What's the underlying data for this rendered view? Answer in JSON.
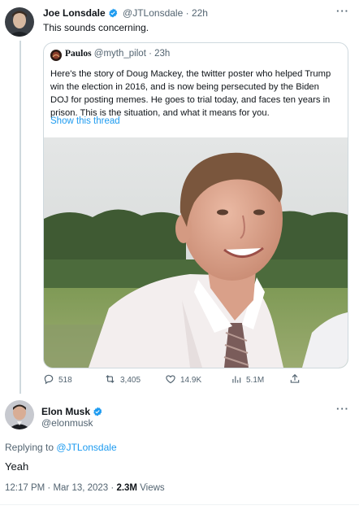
{
  "original_tweet": {
    "author_name": "Joe Lonsdale",
    "handle": "@JTLonsdale",
    "time": "22h",
    "text": "This sounds concerning."
  },
  "quoted_tweet": {
    "author_name": "Paulos",
    "handle": "@myth_pilot",
    "time": "23h",
    "text": "Here's the story of Doug Mackey, the twitter poster who helped Trump win the election in 2016, and is now being persecuted by the Biden DOJ for posting memes. He goes to trial today, and faces ten years in prison. This is the situation, and what it means for you.",
    "show_thread_label": "Show this thread"
  },
  "action_bar": {
    "replies": "518",
    "retweets": "3,405",
    "likes": "14.9K",
    "views": "5.1M"
  },
  "reply_tweet": {
    "author_name": "Elon Musk",
    "handle": "@elonmusk",
    "replying_to_prefix": "Replying to",
    "replying_to_handle": "@JTLonsdale",
    "text": "Yeah",
    "timestamp": "12:17 PM · Mar 13, 2023 ·",
    "views_count": "2.3M",
    "views_label": "Views"
  },
  "more_menu_label": "···",
  "colors": {
    "link_blue": "#1d9bf0",
    "muted_gray": "#536471",
    "border": "#cfd9de",
    "text": "#0f1419"
  }
}
